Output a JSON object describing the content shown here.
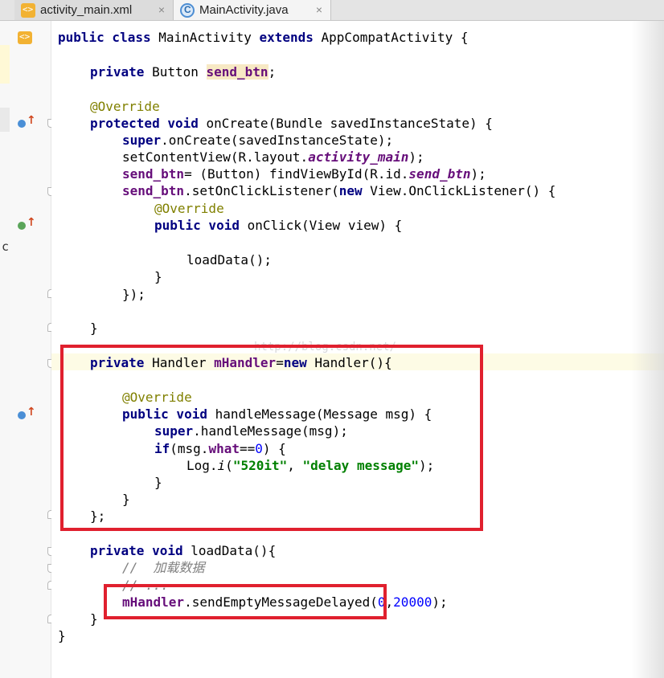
{
  "tabs": [
    {
      "label": "activity_main.xml",
      "icon": "xml-file-icon",
      "close": "×"
    },
    {
      "label": "MainActivity.java",
      "icon": "java-class-icon",
      "close": "×",
      "active": true
    }
  ],
  "left_strip_mark": "c",
  "watermark": "http://blog.csdn.net/",
  "code": {
    "l1": {
      "t1": "public class ",
      "t2": "MainActivity ",
      "t3": "extends ",
      "t4": "AppCompatActivity {"
    },
    "l2": {
      "t1": "private ",
      "t2": "Button ",
      "t3": "send_btn",
      "t4": ";"
    },
    "l3": {
      "t1": "@Override"
    },
    "l4": {
      "t1": "protected void ",
      "t2": "onCreate(Bundle savedInstanceState) {"
    },
    "l5": {
      "t1": "super",
      "t2": ".onCreate(savedInstanceState);"
    },
    "l6": {
      "t1": "setContentView(R.layout.",
      "t2": "activity_main",
      "t3": ");"
    },
    "l7": {
      "t1": "send_btn",
      "t2": "= (Button) findViewById(R.id.",
      "t3": "send_btn",
      "t4": ");"
    },
    "l8": {
      "t1": "send_btn",
      "t2": ".setOnClickListener(",
      "t3": "new ",
      "t4": "View.OnClickListener() {"
    },
    "l9": {
      "t1": "@Override"
    },
    "l10": {
      "t1": "public void ",
      "t2": "onClick(View view) {"
    },
    "l11": {
      "t1": "loadData();"
    },
    "l12": {
      "t1": "}"
    },
    "l13": {
      "t1": "});"
    },
    "l14": {
      "t1": "}"
    },
    "l15": {
      "t1": "private ",
      "t2": "Handler ",
      "t3": "mHandler",
      "t4": "=",
      "t5": "new ",
      "t6": "Handler(){"
    },
    "l16": {
      "t1": "@Override"
    },
    "l17": {
      "t1": "public void ",
      "t2": "handleMessage(Message msg) {"
    },
    "l18": {
      "t1": "super",
      "t2": ".handleMessage(msg);"
    },
    "l19": {
      "t1": "if",
      "t2": "(msg.",
      "t3": "what",
      "t4": "==",
      "t5": "0",
      "t6": ") {"
    },
    "l20": {
      "t1": "Log.",
      "t2": "i",
      "t3": "(",
      "t4": "\"520it\"",
      "t5": ", ",
      "t6": "\"delay message\"",
      "t7": ");"
    },
    "l21": {
      "t1": "}"
    },
    "l22": {
      "t1": "}"
    },
    "l23": {
      "t1": "};"
    },
    "l24": {
      "t1": "private void ",
      "t2": "loadData(){"
    },
    "l25": {
      "t1": "//  加载数据"
    },
    "l26": {
      "t1": "// ..."
    },
    "l27": {
      "t1": "mHandler",
      "t2": ".sendEmptyMessageDelayed(",
      "t3": "0",
      "t4": ",",
      "t5": "20000",
      "t6": ");"
    },
    "l28": {
      "t1": "}"
    },
    "l29": {
      "t1": "}"
    }
  },
  "colors": {
    "keyword": "#000080",
    "annotation": "#808000",
    "string": "#008000",
    "number": "#0000ff",
    "field": "#660e7a",
    "highlight_box": "#e0202e"
  }
}
